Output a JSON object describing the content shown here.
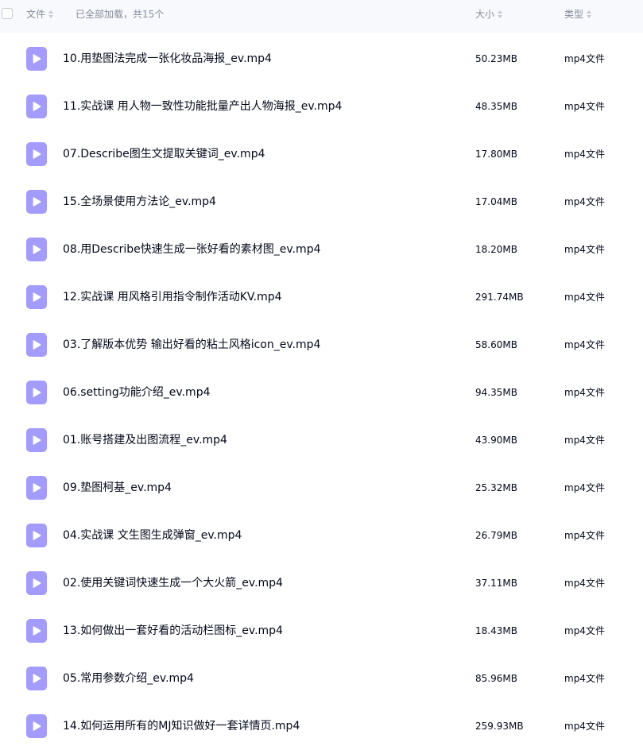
{
  "header": {
    "col_name": "文件",
    "loaded_status": "已全部加载，共15个",
    "col_size": "大小",
    "col_type": "类型"
  },
  "icons": {
    "file_icon": "video-file-icon",
    "sort_icon": "sort-icon",
    "accent_color": "#a49bff"
  },
  "files": [
    {
      "name": "10.用垫图法完成一张化妆品海报_ev.mp4",
      "size": "50.23MB",
      "type": "mp4文件"
    },
    {
      "name": "11.实战课 用人物一致性功能批量产出人物海报_ev.mp4",
      "size": "48.35MB",
      "type": "mp4文件"
    },
    {
      "name": "07.Describe图生文提取关键词_ev.mp4",
      "size": "17.80MB",
      "type": "mp4文件"
    },
    {
      "name": "15.全场景使用方法论_ev.mp4",
      "size": "17.04MB",
      "type": "mp4文件"
    },
    {
      "name": "08.用Describe快速生成一张好看的素材图_ev.mp4",
      "size": "18.20MB",
      "type": "mp4文件"
    },
    {
      "name": "12.实战课 用风格引用指令制作活动KV.mp4",
      "size": "291.74MB",
      "type": "mp4文件"
    },
    {
      "name": "03.了解版本优势 输出好看的粘土风格icon_ev.mp4",
      "size": "58.60MB",
      "type": "mp4文件"
    },
    {
      "name": "06.setting功能介绍_ev.mp4",
      "size": "94.35MB",
      "type": "mp4文件"
    },
    {
      "name": "01.账号搭建及出图流程_ev.mp4",
      "size": "43.90MB",
      "type": "mp4文件"
    },
    {
      "name": "09.垫图柯基_ev.mp4",
      "size": "25.32MB",
      "type": "mp4文件"
    },
    {
      "name": "04.实战课 文生图生成弹窗_ev.mp4",
      "size": "26.79MB",
      "type": "mp4文件"
    },
    {
      "name": "02.使用关键词快速生成一个大火箭_ev.mp4",
      "size": "37.11MB",
      "type": "mp4文件"
    },
    {
      "name": "13.如何做出一套好看的活动栏图标_ev.mp4",
      "size": "18.43MB",
      "type": "mp4文件"
    },
    {
      "name": "05.常用参数介绍_ev.mp4",
      "size": "85.96MB",
      "type": "mp4文件"
    },
    {
      "name": "14.如何运用所有的MJ知识做好一套详情页.mp4",
      "size": "259.93MB",
      "type": "mp4文件"
    }
  ]
}
